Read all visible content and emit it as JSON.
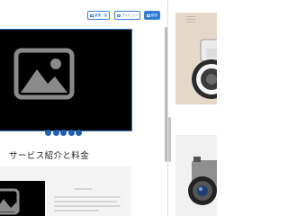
{
  "toolbar": {
    "list_label": "要素一覧",
    "preview_label": "プレビュー",
    "save_label": "保存"
  },
  "content": {
    "section_heading": "サービス紹介と料金"
  },
  "icons": {
    "image_placeholder": "image-icon",
    "list": "list-icon",
    "preview": "eye-icon",
    "save": "save-icon"
  },
  "colors": {
    "accent": "#2b7bd6",
    "selection_outline": "#2f7bd3",
    "image_toolbar": "#1f5fb3",
    "hero_background": "#e4d8c8"
  }
}
